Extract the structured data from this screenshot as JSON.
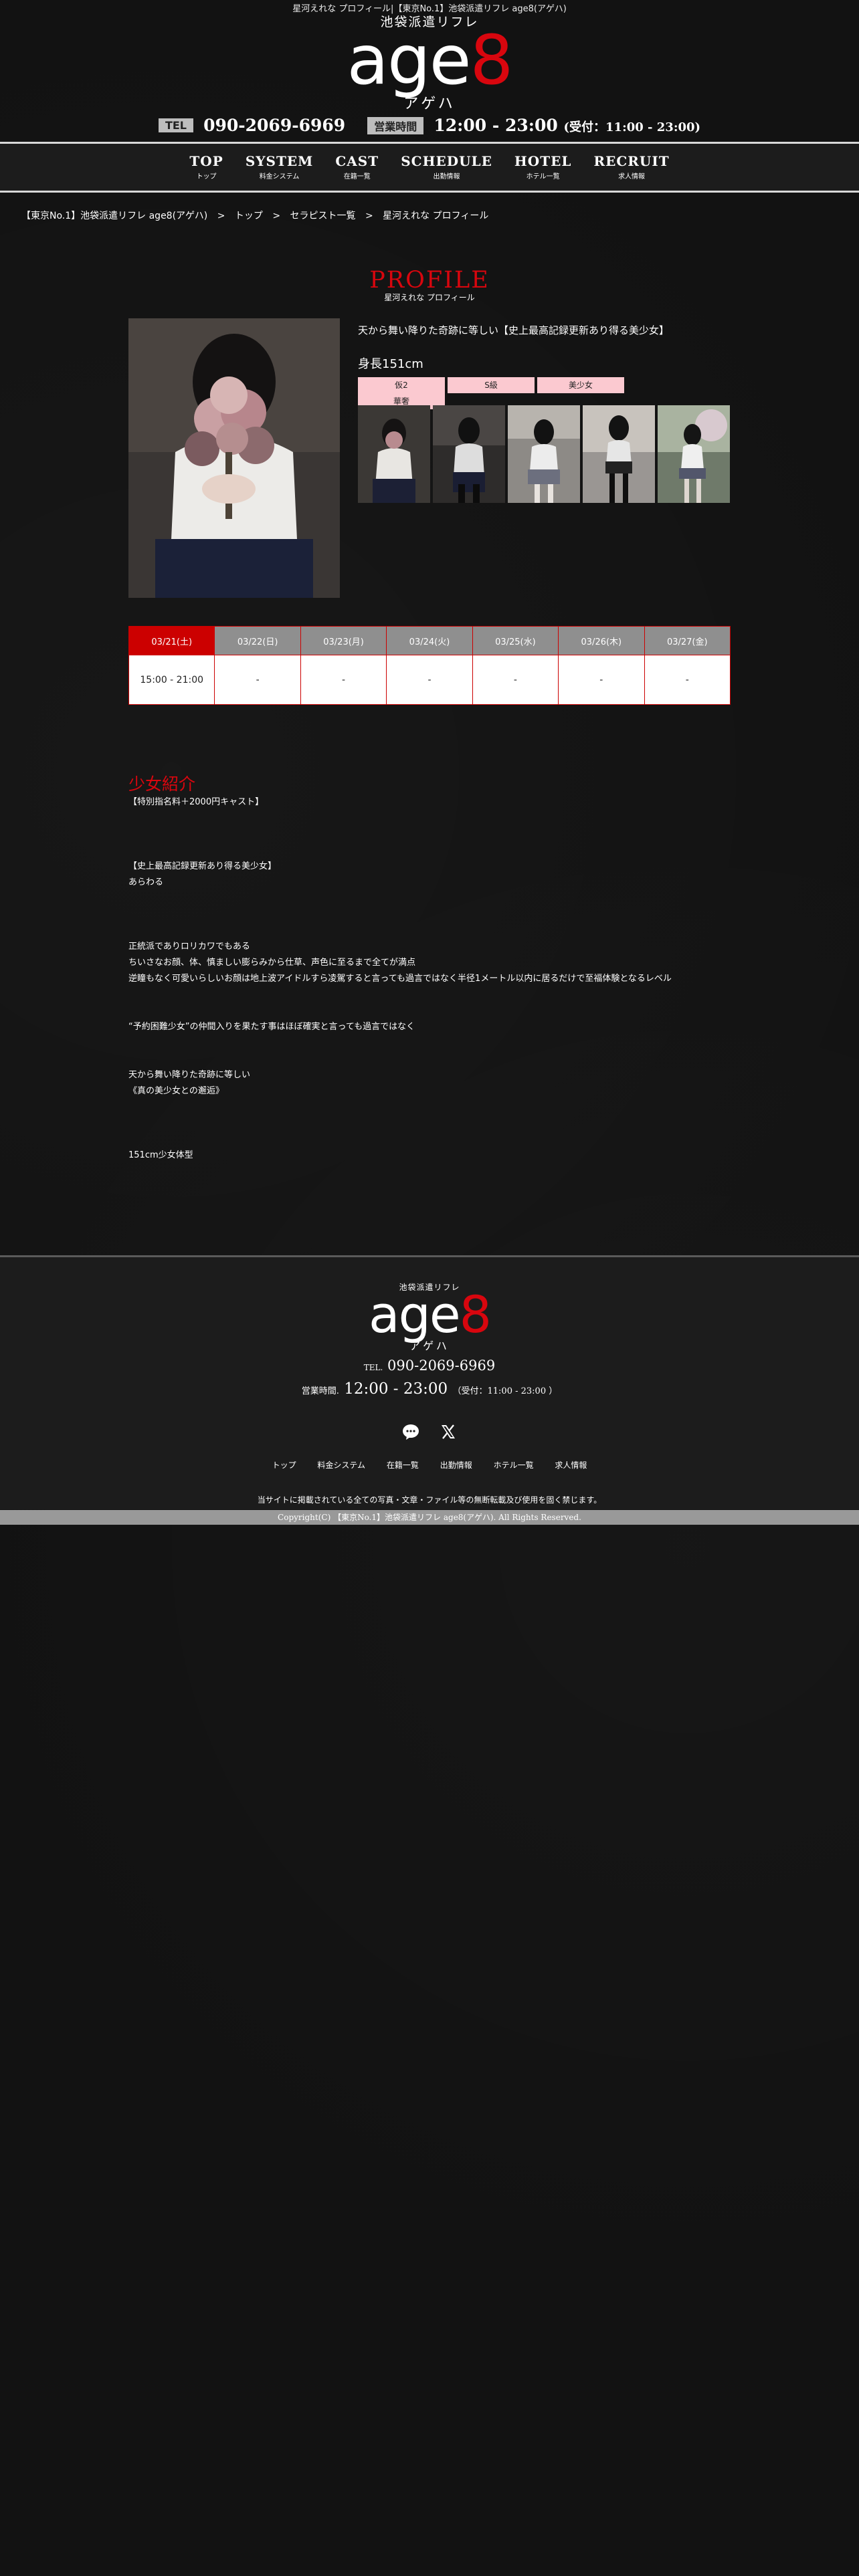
{
  "header": {
    "top_caption": "星河えれな プロフィール|【東京No.1】池袋派遣リフレ age8(アゲハ)",
    "logo_sub": "池袋派遣リフレ",
    "logo_age": "age",
    "logo_eight": "8",
    "logo_kana": "アゲハ",
    "tel_label": "TEL",
    "tel_value": "090-2069-6969",
    "hours_label": "営業時間",
    "hours_value": "12:00 - 23:00",
    "hours_reception": "(受付：11:00 - 23:00)"
  },
  "nav": [
    {
      "en": "TOP",
      "ja": "トップ"
    },
    {
      "en": "SYSTEM",
      "ja": "料金システム"
    },
    {
      "en": "CAST",
      "ja": "在籍一覧"
    },
    {
      "en": "SCHEDULE",
      "ja": "出勤情報"
    },
    {
      "en": "HOTEL",
      "ja": "ホテル一覧"
    },
    {
      "en": "RECRUIT",
      "ja": "求人情報"
    }
  ],
  "breadcrumb": [
    "【東京No.1】池袋派遣リフレ age8(アゲハ)",
    ">",
    "トップ",
    ">",
    "セラピスト一覧",
    ">",
    "星河えれな プロフィール"
  ],
  "profile": {
    "title_en": "PROFILE",
    "title_ja": "星河えれな プロフィール",
    "catch": "天から舞い降りた奇跡に等しい【史上最高記録更新あり得る美少女】",
    "height": "身長151cm",
    "tags": [
      "仮2",
      "S級",
      "美少女",
      "華奢"
    ]
  },
  "schedule": {
    "dates": [
      "03/21(土)",
      "03/22(日)",
      "03/23(月)",
      "03/24(火)",
      "03/25(水)",
      "03/26(木)",
      "03/27(金)"
    ],
    "times": [
      "15:00 - 21:00",
      "-",
      "-",
      "-",
      "-",
      "-",
      "-"
    ]
  },
  "intro": {
    "title": "少女紹介",
    "lines": [
      "【特別指名料＋2000円キャスト】",
      "",
      "",
      "",
      "【史上最高記録更新あり得る美少女】",
      "あらわる",
      "",
      "",
      "",
      "正統派でありロリカワでもある",
      "ちいさなお顔、体、慎ましい膨らみから仕草、声色に至るまで全てが満点",
      "逆瞳もなく可愛いらしいお顔は地上波アイドルすら凌駕すると言っても過言ではなく半径1メートル以内に居るだけで至福体験となるレベル",
      "",
      "",
      "“予約困難少女”の仲間入りを果たす事はほぼ確実と言っても過言ではなく",
      "",
      "",
      "天から舞い降りた奇跡に等しい",
      "《真の美少女との邂逅》",
      "",
      "",
      "",
      "151cm少女体型"
    ]
  },
  "footer": {
    "logo_sub": "池袋派遣リフレ",
    "tel_label": "TEL.",
    "tel_value": "090-2069-6969",
    "hours_label": "営業時間.",
    "hours_value": "12:00 - 23:00",
    "hours_reception": "（受付：11:00 - 23:00 ）",
    "links": [
      "トップ",
      "料金システム",
      "在籍一覧",
      "出勤情報",
      "ホテル一覧",
      "求人情報"
    ],
    "notice": "当サイトに掲載されている全ての写真・文章・ファイル等の無断転載及び使用を固く禁じます。",
    "copyright": "Copyright(C) 【東京No.1】池袋派遣リフレ age8(アゲハ). All Rights Reserved."
  },
  "colors": {
    "accent": "#d8060e",
    "tag_bg": "#fbc9d0",
    "schedule_head": "#8f8f8f"
  }
}
